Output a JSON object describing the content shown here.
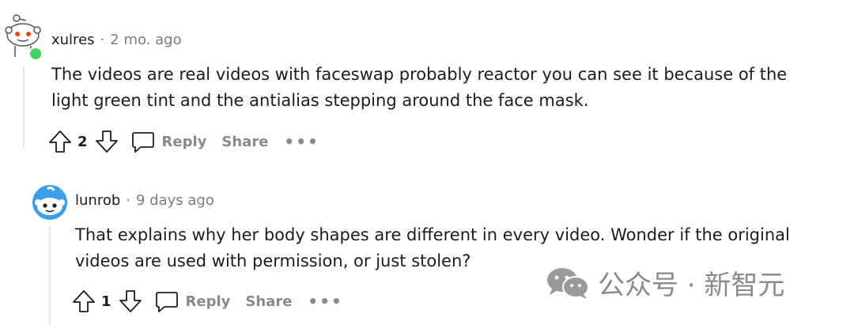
{
  "comments": [
    {
      "username": "xulres",
      "separator": "·",
      "time": "2 mo. ago",
      "body": "The videos are real videos with faceswap probably reactor you can see it because of the light green tint and the antialias stepping around the face mask.",
      "votes": "2",
      "reply_label": "Reply",
      "share_label": "Share",
      "more_label": "•••",
      "online": true
    },
    {
      "username": "lunrob",
      "separator": "·",
      "time": "9 days ago",
      "body": "That explains why her body shapes are different in every video. Wonder if the original videos are used with permission, or just stolen?",
      "votes": "1",
      "reply_label": "Reply",
      "share_label": "Share",
      "more_label": "•••",
      "online": false
    }
  ],
  "watermark": {
    "text": "公众号 · 新智元"
  },
  "colors": {
    "online": "#46d160",
    "avatar_blue": "#3aa0e8",
    "meta_gray": "#7c7c7c",
    "action_gray": "#878a8c"
  }
}
